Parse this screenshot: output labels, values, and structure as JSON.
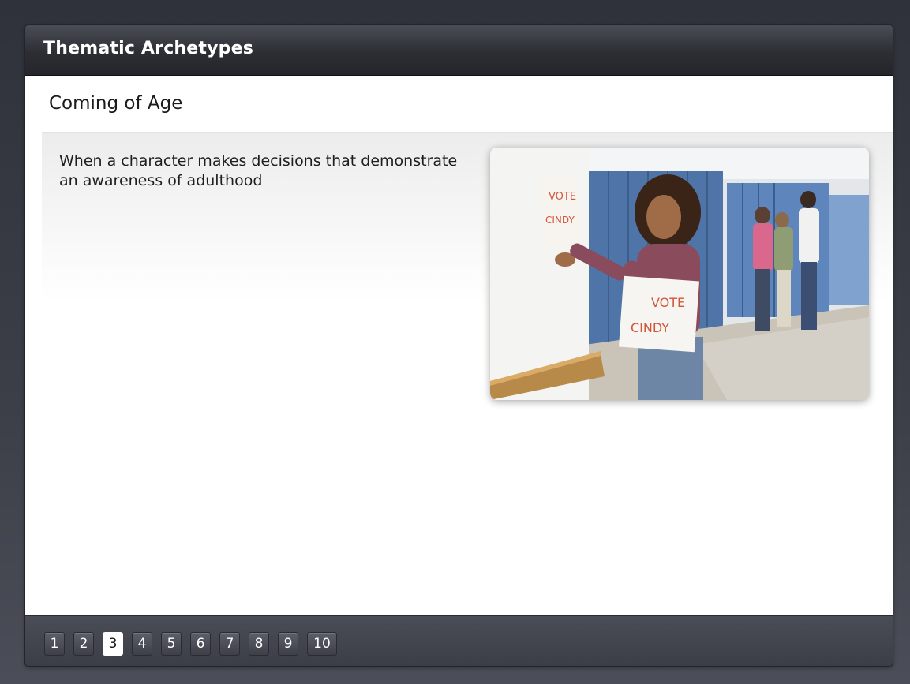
{
  "window": {
    "title": "Thematic Archetypes"
  },
  "slide": {
    "heading": "Coming of Age",
    "description": "When a character makes decisions that demonstrate an awareness of adulthood",
    "photo_signs": [
      "VOTE",
      "CINDY"
    ]
  },
  "pager": {
    "pages": [
      "1",
      "2",
      "3",
      "4",
      "5",
      "6",
      "7",
      "8",
      "9",
      "10"
    ],
    "current": "3"
  },
  "colors": {
    "background": "#3a3c44",
    "titlebar": "#2c2e34",
    "content": "#ffffff",
    "active_page": "#ffffff"
  }
}
